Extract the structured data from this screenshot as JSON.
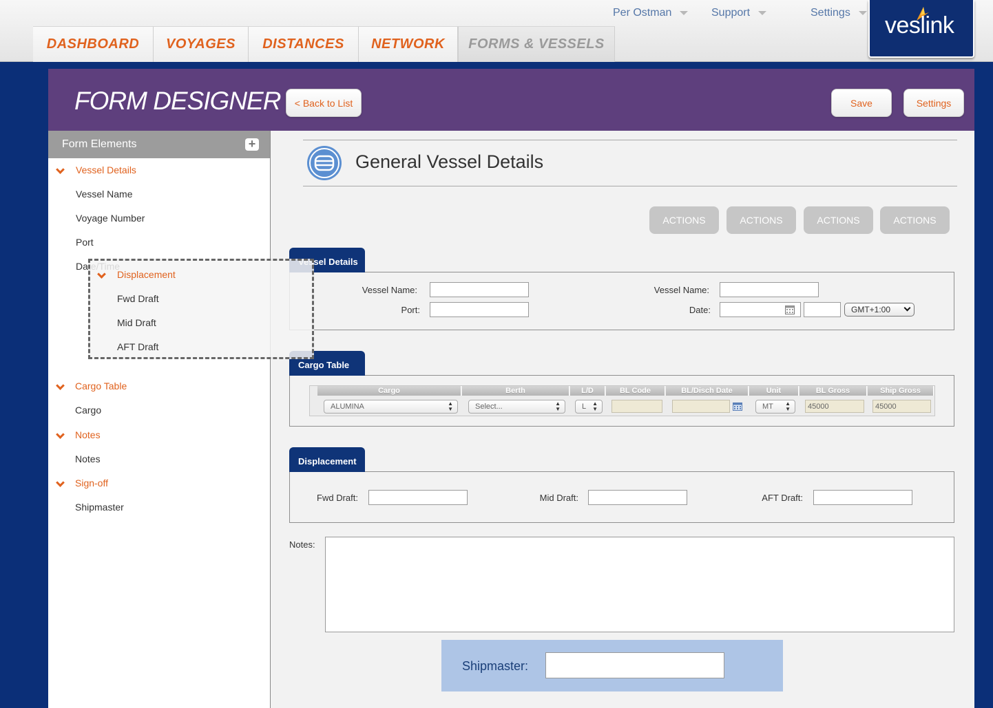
{
  "user_menu": [
    {
      "label": "Per Ostman"
    },
    {
      "label": "Support"
    },
    {
      "label": "Settings"
    }
  ],
  "nav_tabs": [
    {
      "label": "DASHBOARD"
    },
    {
      "label": "VOYAGES"
    },
    {
      "label": "DISTANCES"
    },
    {
      "label": "NETWORK"
    },
    {
      "label": "FORMS & VESSELS"
    }
  ],
  "logo": {
    "text": "veslink"
  },
  "header": {
    "title": "FORM DESIGNER",
    "back_label": "< Back to List",
    "save_label": "Save",
    "settings_label": "Settings"
  },
  "sidebar": {
    "title": "Form Elements",
    "plus": "+",
    "groups": [
      {
        "label": "Vessel Details",
        "items": [
          "Vessel Name",
          "Voyage Number",
          "Port",
          "Date/Time"
        ]
      },
      {
        "label": "Cargo Table",
        "items": [
          "Cargo"
        ]
      },
      {
        "label": "Notes",
        "items": [
          "Notes"
        ]
      },
      {
        "label": "Sign-off",
        "items": [
          "Shipmaster"
        ]
      }
    ],
    "dragging": {
      "label": "Displacement",
      "items": [
        "Fwd Draft",
        "Mid Draft",
        "AFT Draft"
      ]
    }
  },
  "form": {
    "title": "General Vessel Details",
    "actions": [
      "ACTIONS",
      "ACTIONS",
      "ACTIONS",
      "ACTIONS"
    ],
    "vessel_details": {
      "tab": "Vessel Details",
      "vessel_name_label": "Vessel Name:",
      "port_label": "Port:",
      "vessel_name2_label": "Vessel Name:",
      "date_label": "Date:",
      "timezone": "GMT+1:00"
    },
    "cargo_table": {
      "tab": "Cargo Table",
      "columns": [
        "Cargo",
        "Berth",
        "L/D",
        "BL Code",
        "BL/Disch Date",
        "Unit",
        "BL Gross",
        "Ship Gross"
      ],
      "row": {
        "cargo": "ALUMINA",
        "berth": "Select...",
        "ld": "L",
        "bl_code": "",
        "bl_date": "",
        "unit": "MT",
        "bl_gross": "45000",
        "ship_gross": "45000"
      }
    },
    "displacement": {
      "tab": "Displacement",
      "fwd_label": "Fwd Draft:",
      "mid_label": "Mid Draft:",
      "aft_label": "AFT Draft:"
    },
    "notes_label": "Notes:",
    "shipmaster_label": "Shipmaster:"
  },
  "colors": {
    "accent_orange": "#e0621e",
    "navy": "#0f3478",
    "purple": "#5e3f7d",
    "shipmaster_bg": "#aec5e6"
  }
}
